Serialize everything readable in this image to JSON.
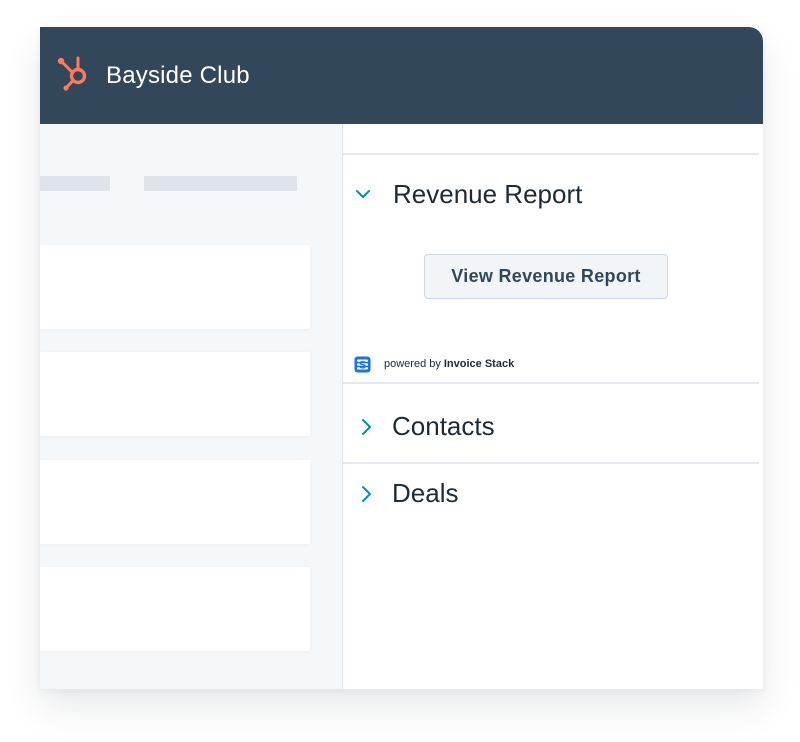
{
  "header": {
    "logo_icon": "sprocket-logo-icon",
    "title": "Bayside Club",
    "background": "#33475b",
    "accent": "#ff7a59"
  },
  "sidebar_panel": {
    "sections": [
      {
        "title": "Revenue Report",
        "expanded": true,
        "chevron_icon": "chevron-down-icon",
        "button_label": "View Revenue Report",
        "powered_by": {
          "icon": "invoice-stack-logo-icon",
          "prefix": "powered by",
          "brand": "Invoice Stack"
        }
      },
      {
        "title": "Contacts",
        "expanded": false,
        "chevron_icon": "chevron-right-icon"
      },
      {
        "title": "Deals",
        "expanded": false,
        "chevron_icon": "chevron-right-icon"
      }
    ],
    "chevron_color": "#0091ae"
  }
}
